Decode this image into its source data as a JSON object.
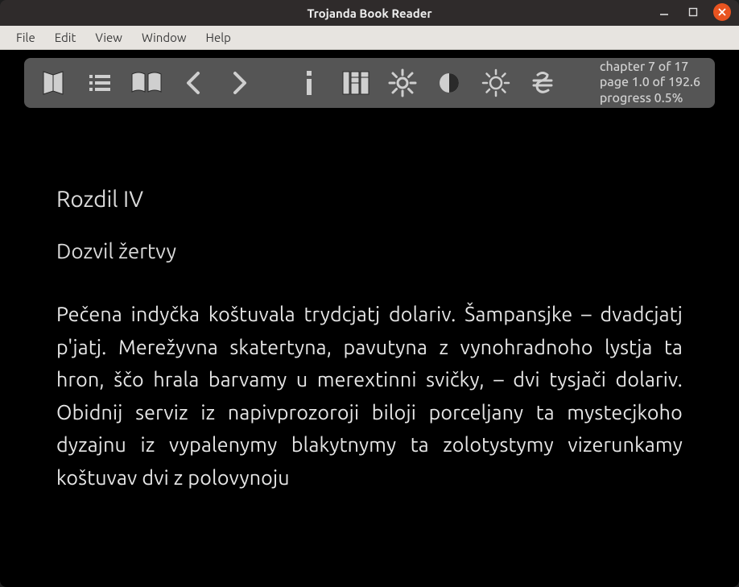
{
  "window": {
    "title": "Trojanda Book Reader"
  },
  "menu": {
    "file": "File",
    "edit": "Edit",
    "view": "View",
    "window": "Window",
    "help": "Help"
  },
  "toolbar": {
    "icons": {
      "library": "library-icon",
      "toc": "toc-icon",
      "twopage": "two-page-icon",
      "prev": "prev-icon",
      "next": "next-icon",
      "info": "info-icon",
      "app": "app-mark-icon",
      "settings": "settings-icon",
      "contrast": "contrast-icon",
      "brightness": "brightness-icon",
      "currency": "hryvnia-icon"
    }
  },
  "status": {
    "chapter_line": "chapter 7 of 17",
    "page_line": "page 1.0 of 192.6",
    "progress_line": "progress 0.5%"
  },
  "content": {
    "chapter_num": "Rozdil IV",
    "chapter_title": "Dozvil žertvy",
    "body": "Pečena indyčka koštuvala trydcjatj dolariv. Šampansjke – dvadcjatj p'jatj. Merežyvna skatertyna, pavutyna z vynohradnoho lystja ta hron, ščo hrala barvamy u merextinni svičky, – dvi tysjači dolariv. Obidnij serviz iz napivprozoroji biloji porceljany ta mystecjkoho dyzajnu iz vypalenymy blakytnymy ta zolotystymy vizerunkamy koštuvav dvi z polovynoju"
  }
}
